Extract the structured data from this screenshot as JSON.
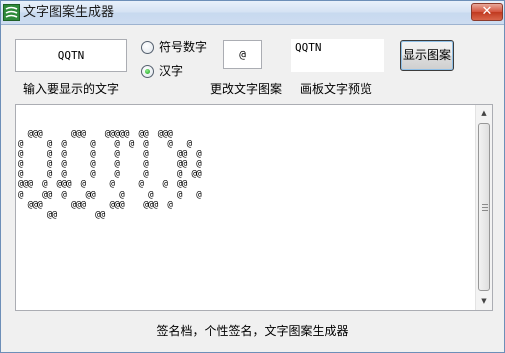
{
  "window": {
    "title": "文字图案生成器",
    "close_glyph": "✕"
  },
  "input": {
    "value": "QQTN",
    "label": "输入要显示的文字"
  },
  "mode": {
    "options": [
      {
        "label": "符号数字",
        "checked": false
      },
      {
        "label": "汉字",
        "checked": true
      }
    ]
  },
  "pattern_char": {
    "value": "@",
    "label": "更改文字图案"
  },
  "preview": {
    "value": "QQTN",
    "label": "画板文字预览"
  },
  "show_button": {
    "label": "显示图案"
  },
  "output": {
    "ascii": "  @@@      @@@    @@@@@  @@  @@@\n@     @  @     @    @  @  @    @   @\n@     @  @     @    @     @      @@  @\n@     @  @     @    @     @      @@  @\n@     @  @     @    @     @      @  @@\n@@@  @  @@@  @     @     @    @  @@\n@    @@  @    @@     @     @     @   @\n  @@@      @@@     @@@    @@@  @\n      @@        @@"
  },
  "footer": {
    "text": "签名档，个性签名，文字图案生成器"
  },
  "colors": {
    "window_bg": "#f0f0f0",
    "border": "#6d8fb8",
    "close_red": "#c0391f",
    "radio_green": "#169a16"
  }
}
